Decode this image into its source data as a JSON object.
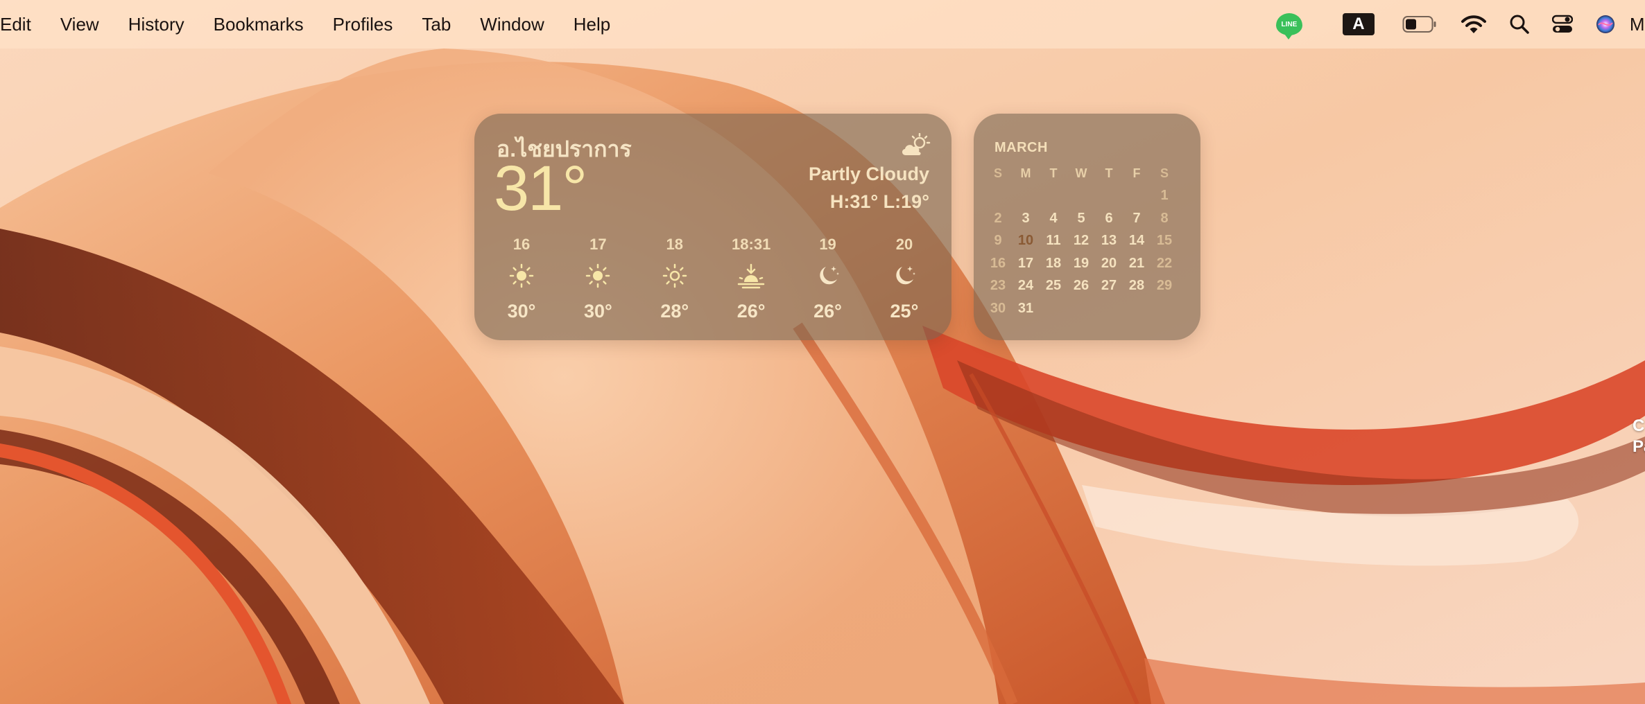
{
  "menubar": {
    "items": [
      "Edit",
      "View",
      "History",
      "Bookmarks",
      "Profiles",
      "Tab",
      "Window",
      "Help"
    ],
    "status": {
      "line_label": "LINE",
      "input_source": "A",
      "clock": "Mo"
    }
  },
  "weather": {
    "city": "อ.ไชยปราการ",
    "temp": "31°",
    "condition": "Partly Cloudy",
    "hilo": "H:31° L:19°",
    "hours": [
      {
        "time": "16",
        "icon": "sun-icon",
        "temp": "30°"
      },
      {
        "time": "17",
        "icon": "sun-icon",
        "temp": "30°"
      },
      {
        "time": "18",
        "icon": "sun-icon",
        "temp": "28°"
      },
      {
        "time": "18:31",
        "icon": "sunset-icon",
        "temp": "26°"
      },
      {
        "time": "19",
        "icon": "moon-icon",
        "temp": "26°"
      },
      {
        "time": "20",
        "icon": "moon-icon",
        "temp": "25°"
      }
    ]
  },
  "calendar": {
    "month": "MARCH",
    "weekdays": [
      "S",
      "M",
      "T",
      "W",
      "T",
      "F",
      "S"
    ],
    "weeks": [
      [
        "",
        "",
        "",
        "",
        "",
        "",
        "1"
      ],
      [
        "2",
        "3",
        "4",
        "5",
        "6",
        "7",
        "8"
      ],
      [
        "9",
        "10",
        "11",
        "12",
        "13",
        "14",
        "15"
      ],
      [
        "16",
        "17",
        "18",
        "19",
        "20",
        "21",
        "22"
      ],
      [
        "23",
        "24",
        "25",
        "26",
        "27",
        "28",
        "29"
      ],
      [
        "30",
        "31",
        "",
        "",
        "",
        "",
        ""
      ]
    ],
    "today": "10"
  },
  "desktop": {
    "edge_label_1": "C",
    "edge_label_2": "Pa"
  }
}
